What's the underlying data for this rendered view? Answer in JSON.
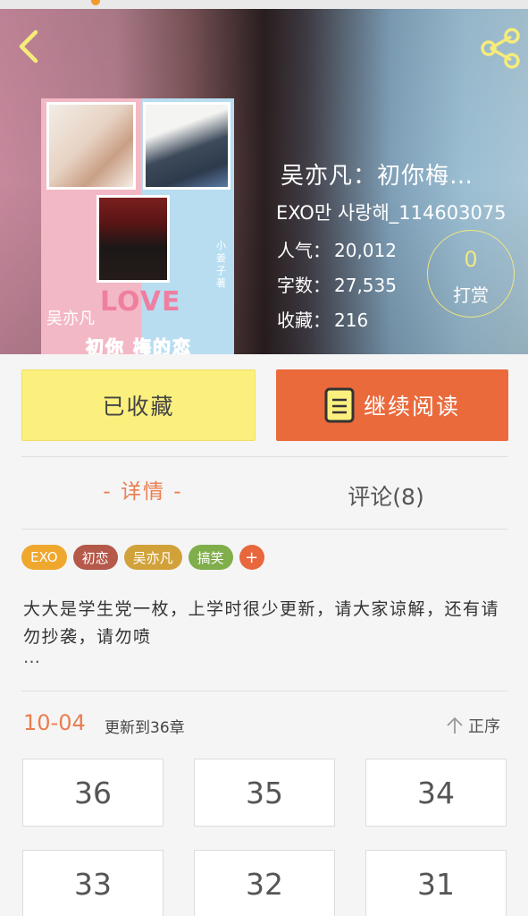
{
  "header": {
    "back_icon": "chevron-left-icon",
    "share_icon": "share-icon"
  },
  "cover": {
    "love_text": "LOVE",
    "title_line1": "吴亦凡",
    "title_line2": "初你 梅的恋",
    "side_text": "小姜子著"
  },
  "book": {
    "title": "吴亦凡：初你梅…",
    "author": "EXO만 사랑해_114603075",
    "stats": [
      {
        "label": "人气：",
        "value": "20,012"
      },
      {
        "label": "字数：",
        "value": "27,535"
      },
      {
        "label": "收藏：",
        "value": "216"
      }
    ],
    "tip": {
      "count": "0",
      "label": "打赏"
    }
  },
  "actions": {
    "collected_label": "已收藏",
    "read_label": "继续阅读"
  },
  "tabs": {
    "details": "- 详情 -",
    "comments": "评论(8)"
  },
  "tags": [
    {
      "label": "EXO",
      "color": "#f0a72e"
    },
    {
      "label": "初恋",
      "color": "#b5594a"
    },
    {
      "label": "吴亦凡",
      "color": "#d2a23a"
    },
    {
      "label": "搞笑",
      "color": "#7fae4b"
    }
  ],
  "tag_add": "+",
  "description": {
    "text": "大大是学生党一枚，上学时很少更新，请大家谅解，还有请勿抄袭，请勿喷",
    "more": "…"
  },
  "updates": {
    "date": "10-04",
    "text": "更新到36章",
    "sort_label": "正序"
  },
  "chapters": [
    "36",
    "35",
    "34",
    "33",
    "32",
    "31"
  ],
  "colors": {
    "accent_orange": "#ea6a3c",
    "collected_yellow": "#fbf07e",
    "tip_gold": "#f1e77f"
  }
}
